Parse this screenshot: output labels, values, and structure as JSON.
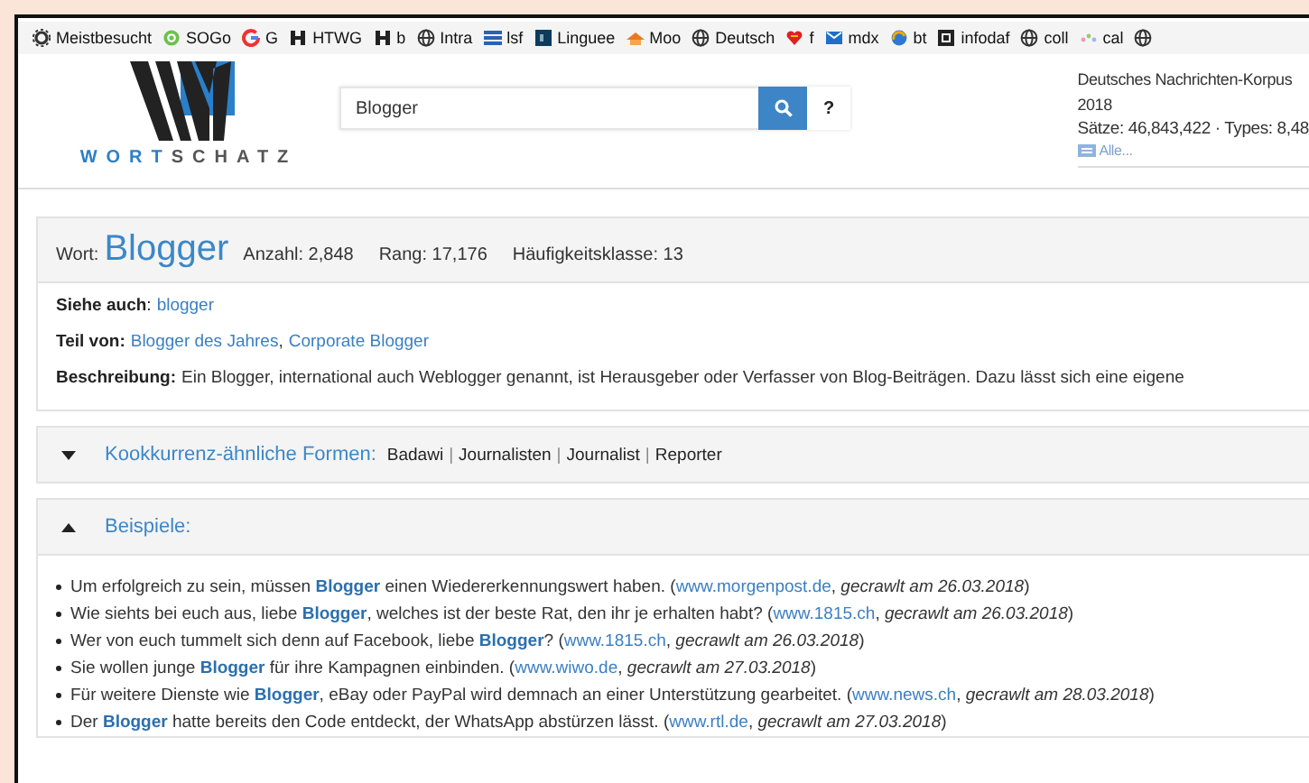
{
  "bookmarks": [
    {
      "label": "Meistbesucht"
    },
    {
      "label": "SOGo"
    },
    {
      "label": "G"
    },
    {
      "label": "HTWG"
    },
    {
      "label": "b"
    },
    {
      "label": "Intra"
    },
    {
      "label": "lsf"
    },
    {
      "label": "Linguee"
    },
    {
      "label": "Moo"
    },
    {
      "label": "Deutsch"
    },
    {
      "label": "f"
    },
    {
      "label": "mdx"
    },
    {
      "label": "bt"
    },
    {
      "label": "infodaf"
    },
    {
      "label": "coll"
    },
    {
      "label": "cal"
    }
  ],
  "header": {
    "wordmark": [
      "WORT",
      "SCHATZ"
    ],
    "search": {
      "value": "Blogger"
    },
    "help": "?",
    "corpus": {
      "name": "Deutsches Nachrichten-Korpus",
      "year": "2018",
      "stats": "Sätze: 46,843,422 · Types: 8,48",
      "all_link": "Alle..."
    }
  },
  "word_card": {
    "word_label": "Wort:",
    "word": "Blogger",
    "stats": [
      "Anzahl: 2,848",
      "Rang: 17,176",
      "Häufigkeitsklasse: 13"
    ],
    "see_also": {
      "label": "**Siehe auch**:",
      "links": [
        "blogger"
      ]
    },
    "part_of": {
      "label": "**Teil von:**",
      "separator": ",",
      "links": [
        "Blogger des Jahres",
        "Corporate Blogger"
      ]
    },
    "description": {
      "label": "Beschreibung:",
      "text": "Ein Blogger, international auch Weblogger genannt, ist Herausgeber oder Verfasser von Blog-Beiträgen. Dazu lässt sich eine eigene"
    }
  },
  "panels": [
    {
      "title": "Kookkurrenz-ähnliche Formen:",
      "expanded": false,
      "separator": "|",
      "terms": [
        "Badawi",
        "Journalisten",
        "Journalist",
        "Reporter"
      ]
    },
    {
      "title": "Beispiele:",
      "expanded": true,
      "examples": [
        {
          "text": "Um erfolgreich zu sein, müssen **Blogger** einen Wiedererkennungswert haben. (",
          "source": "www.morgenpost.de",
          "date": ", *gecrawlt am 26.03.2018*)"
        },
        {
          "text": "Wie siehts bei euch aus, liebe **Blogger**, welches ist der beste Rat, den ihr je erhalten habt? (",
          "source": "www.1815.ch",
          "date": ", *gecrawlt am 26.03.2018*)"
        },
        {
          "text": "Wer von euch tummelt sich denn auf Facebook, liebe **Blogger**? (",
          "source": "www.1815.ch",
          "date": ", *gecrawlt am 26.03.2018*)"
        },
        {
          "text": "Sie wollen junge **Blogger** für ihre Kampagnen einbinden. (",
          "source": "www.wiwo.de",
          "date": ", *gecrawlt am 27.03.2018*)"
        },
        {
          "text": "Für weitere Dienste wie **Blogger**, eBay oder PayPal wird demnach an einer Unterstützung gearbeitet. (",
          "source": "www.news.ch",
          "date": ", *gecrawlt am 28.03.2018*)"
        },
        {
          "text": "Der **Blogger** hatte bereits den Code entdeckt, der WhatsApp abstürzen lässt. (",
          "source": "www.rtl.de",
          "date": ", *gecrawlt am 27.03.2018*)"
        }
      ]
    }
  ]
}
